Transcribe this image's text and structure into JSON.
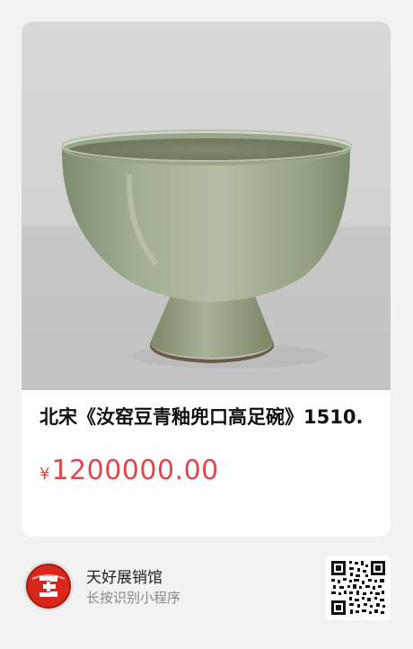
{
  "product": {
    "title": "北宋《汝窑豆青釉兜口高足碗》1510.",
    "currency_symbol": "¥",
    "price": "1200000.00",
    "price_color": "#e0474c"
  },
  "store": {
    "name": "天好展销馆",
    "hint": "长按识别小程序",
    "logo_icon": "store-logo-icon",
    "qr_icon": "mini-program-qr-code"
  },
  "colors": {
    "glaze": "#9aa88a",
    "background": "#f2f2f2"
  }
}
